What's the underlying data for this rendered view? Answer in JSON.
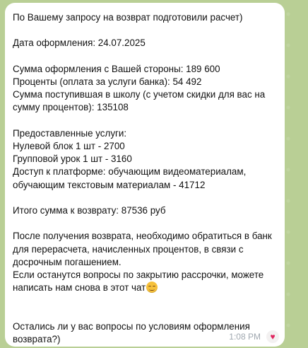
{
  "message": {
    "lines": [
      "По Вашему запросу на возврат подготовили расчет)",
      "",
      "Дата оформления: 24.07.2025",
      "",
      "Сумма оформления с Вашей стороны: 189 600",
      "Проценты (оплата за услуги банка): 54 492",
      "Сумма поступившая в школу (с учетом скидки для вас на",
      "сумму процентов): 135108",
      "",
      "Предоставленные услуги:",
      "Нулевой блок 1 шт - 2700",
      "Групповой урок 1 шт - 3160",
      "Доступ к платформе: обучающим видеоматериалам,",
      "обучающим текстовым материалам - 41712",
      "",
      "Итого сумма к возврату: 87536 руб",
      "",
      "После получения возврата, необходимо обратиться в банк",
      "для перерасчета, начисленных процентов, в связи с",
      "досрочным погашением.",
      "Если останутся вопросы по закрытию рассрочки, можете",
      "написать нам снова в этот чат",
      "",
      "",
      "Остались ли у вас вопросы по условиям оформления",
      "возврата?)"
    ],
    "emoji": "smiling-face-icon",
    "time": "1:08 PM",
    "reaction": "♥",
    "reaction_icon": "heart-icon"
  },
  "colors": {
    "chat_background": "#b9cf95",
    "bubble": "#ffffff",
    "time": "#a0a8b0",
    "reaction": "#e0245e"
  }
}
